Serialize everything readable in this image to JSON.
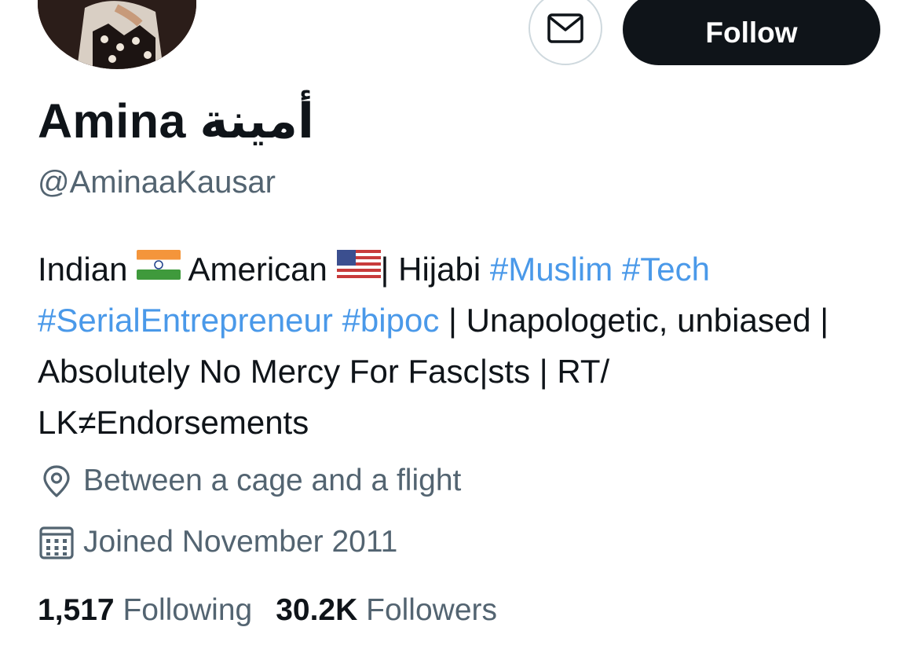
{
  "profile": {
    "display_name": "Amina",
    "display_name_arabic": "أمينة",
    "handle": "@AminaaKausar"
  },
  "actions": {
    "follow_label": "Follow",
    "message_icon": "envelope-icon"
  },
  "bio": {
    "t1": "Indian",
    "flag1": "india-flag-icon",
    "t2": "American",
    "flag2": "usa-flag-icon",
    "t3": "| Hijabi",
    "tag1": "#Muslim",
    "tag2": "#Tech",
    "tag3": "#SerialEntrepreneur",
    "tag4": "#bipoc",
    "t4": "| Unapologetic, unbiased | Absolutely No Mercy For Fasc|sts | RT/ LK≠Endorsements"
  },
  "meta": {
    "location": "Between a cage and a flight",
    "location_icon": "location-pin-icon",
    "joined": "Joined November 2011",
    "joined_icon": "calendar-icon"
  },
  "stats": {
    "following_count": "1,517",
    "following_label": "Following",
    "followers_count": "30.2K",
    "followers_label": "Followers"
  },
  "colors": {
    "text": "#0f1419",
    "secondary": "#536471",
    "hashtag": "#4a99e9",
    "follow_bg": "#0f1419",
    "border": "#cfd9de"
  }
}
